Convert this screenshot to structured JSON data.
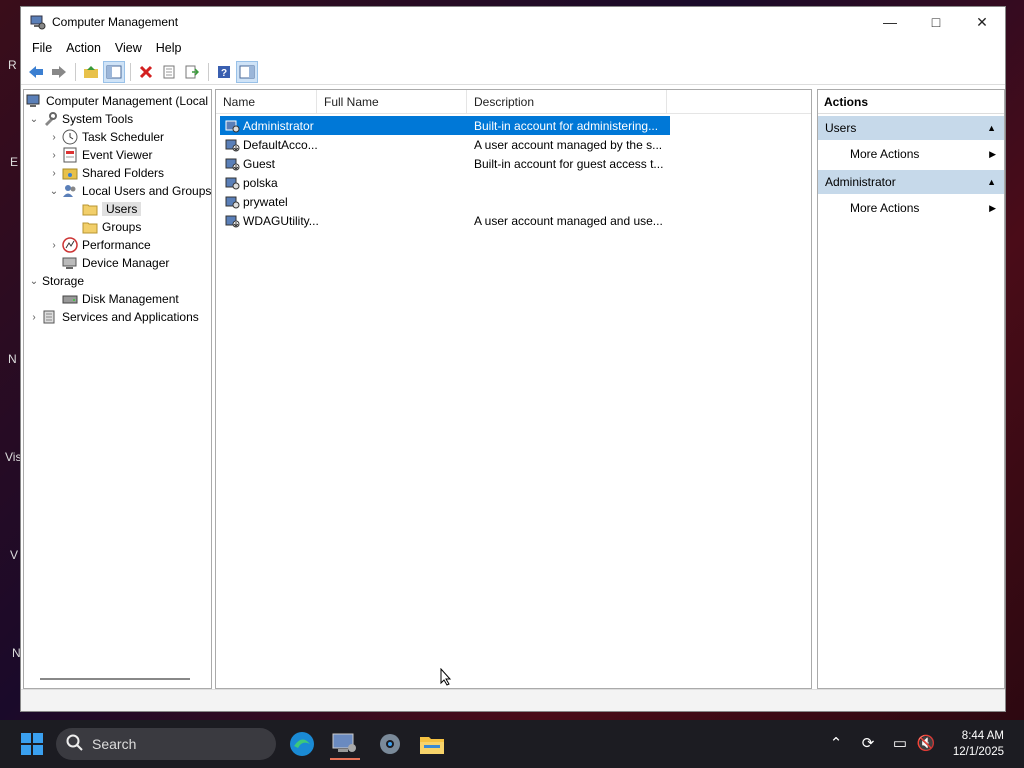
{
  "window": {
    "title": "Computer Management"
  },
  "menu": [
    "File",
    "Action",
    "View",
    "Help"
  ],
  "tree": {
    "root": "Computer Management (Local",
    "system_tools": "System Tools",
    "task_scheduler": "Task Scheduler",
    "event_viewer": "Event Viewer",
    "shared_folders": "Shared Folders",
    "local_users_groups": "Local Users and Groups",
    "users": "Users",
    "groups": "Groups",
    "performance": "Performance",
    "device_manager": "Device Manager",
    "storage": "Storage",
    "disk_management": "Disk Management",
    "services_apps": "Services and Applications"
  },
  "list": {
    "columns": [
      "Name",
      "Full Name",
      "Description"
    ],
    "rows": [
      {
        "name": "Administrator",
        "full_name": "",
        "description": "Built-in account for administering..."
      },
      {
        "name": "DefaultAcco...",
        "full_name": "",
        "description": "A user account managed by the s..."
      },
      {
        "name": "Guest",
        "full_name": "",
        "description": "Built-in account for guest access t..."
      },
      {
        "name": "polska",
        "full_name": "",
        "description": ""
      },
      {
        "name": "prywatel",
        "full_name": "",
        "description": ""
      },
      {
        "name": "WDAGUtility...",
        "full_name": "",
        "description": "A user account managed and use..."
      }
    ]
  },
  "actions": {
    "title": "Actions",
    "section1": "Users",
    "section1_item": "More Actions",
    "section2": "Administrator",
    "section2_item": "More Actions"
  },
  "taskbar": {
    "search_placeholder": "Search",
    "time": "8:44 AM",
    "date": "12/1/2025"
  },
  "colors": {
    "selection": "#0078d7",
    "section_header": "#c6d9ea"
  }
}
